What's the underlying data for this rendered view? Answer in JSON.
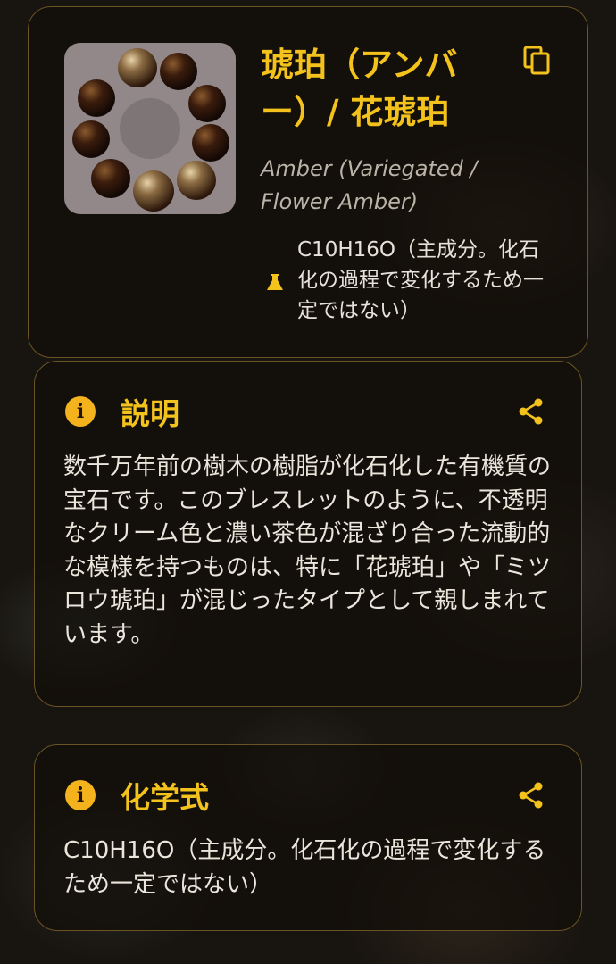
{
  "gem": {
    "title": "琥珀（アンバー）/ 花琥珀",
    "subtitle": "Amber (Variegated / Flower Amber)",
    "formula": "C10H16O（主成分。化石化の過程で変化するため一定ではない）"
  },
  "description": {
    "heading": "説明",
    "body": "数千万年前の樹木の樹脂が化石化した有機質の宝石です。このブレスレットのように、不透明なクリーム色と濃い茶色が混ざり合った流動的な模様を持つものは、特に「花琥珀」や「ミツロウ琥珀」が混じったタイプとして親しまれています。"
  },
  "chemical": {
    "heading": "化学式",
    "body": "C10H16O（主成分。化石化の過程で変化するため一定ではない）"
  },
  "colors": {
    "accent": "#f3c21c",
    "card_border": "#6b5424",
    "text": "#ebe6dc"
  },
  "icons": {
    "copy": "copy-icon",
    "flask": "flask-icon",
    "info": "info-icon",
    "share": "share-icon"
  }
}
